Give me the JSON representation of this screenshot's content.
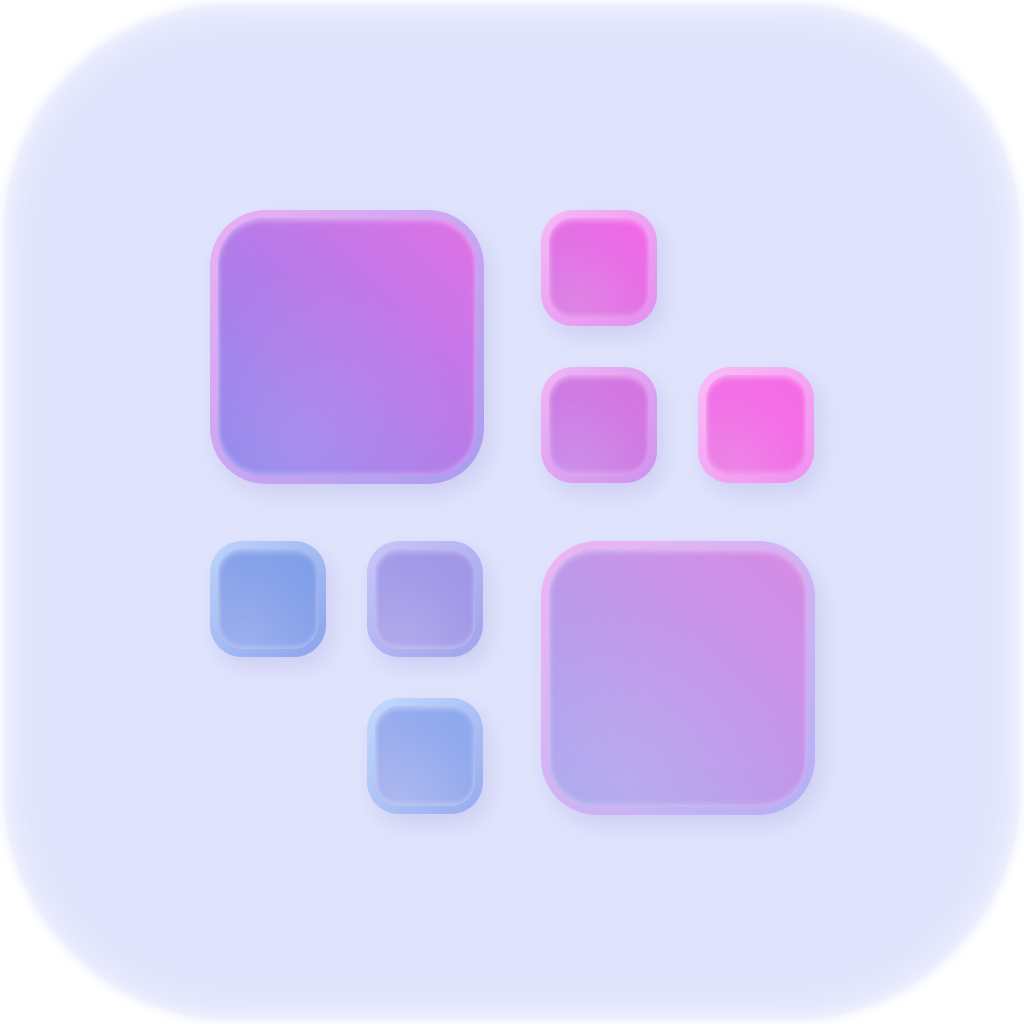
{
  "icon": {
    "name": "grid-squares-icon",
    "background_color": "#e0e4fc"
  },
  "tiles": [
    {
      "name": "tile-large-top-left",
      "border": [
        "#eab0f4",
        "#a99cf0"
      ],
      "fill": [
        "#e071e6",
        "#8b86ec"
      ]
    },
    {
      "name": "tile-small-top-a",
      "border": [
        "#f6b8f6",
        "#e38ef0"
      ],
      "fill": [
        "#f466e8",
        "#d47ae2"
      ]
    },
    {
      "name": "tile-small-mid-a",
      "border": [
        "#f2b5f5",
        "#cd92ee"
      ],
      "fill": [
        "#d872e2",
        "#c584e6"
      ]
    },
    {
      "name": "tile-small-mid-b",
      "border": [
        "#f9bdf6",
        "#ef8ff0"
      ],
      "fill": [
        "#f868e8",
        "#ea78e4"
      ]
    },
    {
      "name": "tile-small-bottom-left-a",
      "border": [
        "#bdd4fc",
        "#8ba2ec"
      ],
      "fill": [
        "#7e9ee8",
        "#93a7ec"
      ]
    },
    {
      "name": "tile-small-bottom-left-b",
      "border": [
        "#c9c6fa",
        "#9da4ec"
      ],
      "fill": [
        "#9f95e6",
        "#a8a2ea"
      ]
    },
    {
      "name": "tile-small-bottom-left-c",
      "border": [
        "#c3dafd",
        "#97abef"
      ],
      "fill": [
        "#8aa8ee",
        "#a6b0ee"
      ]
    },
    {
      "name": "tile-large-bottom-right",
      "border": [
        "#efb5f3",
        "#b4b0f6"
      ],
      "fill": [
        "#d88ae6",
        "#a7a6ee"
      ]
    }
  ]
}
